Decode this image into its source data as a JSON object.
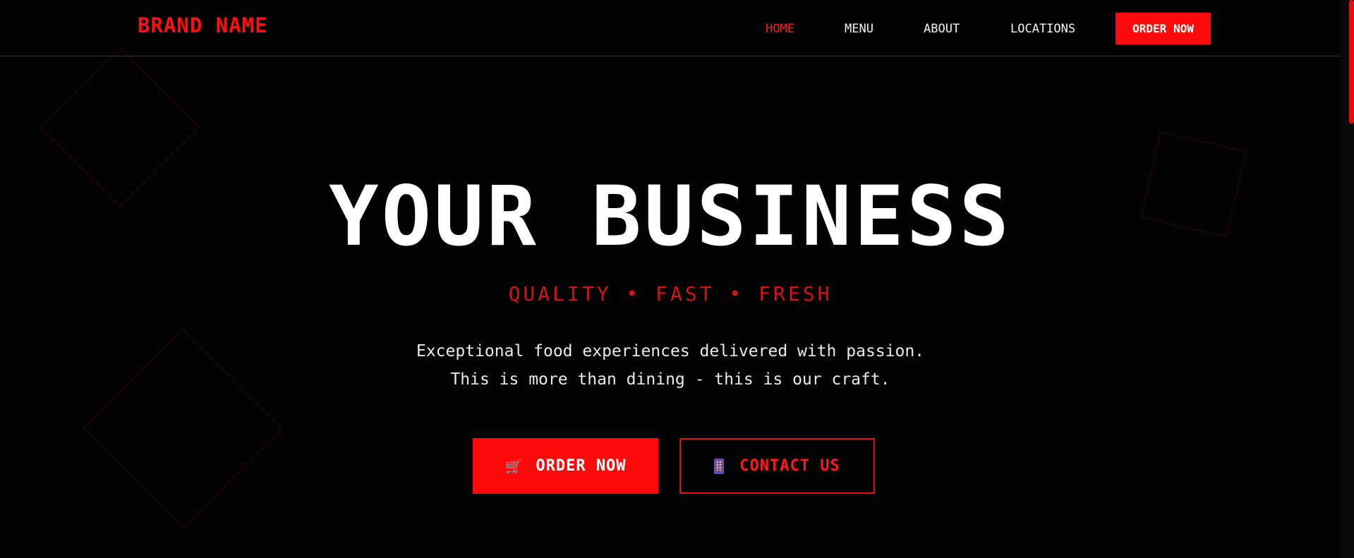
{
  "header": {
    "brand": "BRAND NAME",
    "nav": [
      {
        "label": "HOME",
        "active": true
      },
      {
        "label": "MENU",
        "active": false
      },
      {
        "label": "ABOUT",
        "active": false
      },
      {
        "label": "LOCATIONS",
        "active": false
      }
    ],
    "order_button": "ORDER NOW"
  },
  "hero": {
    "title": "YOUR BUSINESS",
    "tagline": "QUALITY • FAST • FRESH",
    "description_line1": "Exceptional food experiences delivered with passion.",
    "description_line2": "This is more than dining - this is our craft.",
    "primary_button": {
      "label": "ORDER NOW",
      "icon": "cart-icon",
      "glyph": "🛒"
    },
    "secondary_button": {
      "label": "CONTACT US",
      "icon": "phone-icon"
    }
  },
  "colors": {
    "background": "#030303",
    "accent": "#ff0a0a",
    "text": "#ffffff"
  }
}
